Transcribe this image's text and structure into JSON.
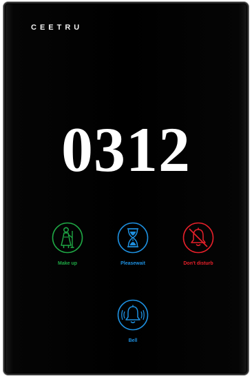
{
  "brand": "CEETRU",
  "room_number": "0312",
  "buttons": {
    "make_up": {
      "label": "Make up",
      "color": "#1fa845",
      "icon": "maid-icon"
    },
    "please_wait": {
      "label": "Pleasewait",
      "color": "#1e90e0",
      "icon": "hourglass-icon"
    },
    "do_not_disturb": {
      "label": "Don't disturb",
      "color": "#e8202a",
      "icon": "bell-slash-icon"
    },
    "bell": {
      "label": "Bell",
      "color": "#1e90e0",
      "icon": "ringing-bell-icon"
    }
  }
}
